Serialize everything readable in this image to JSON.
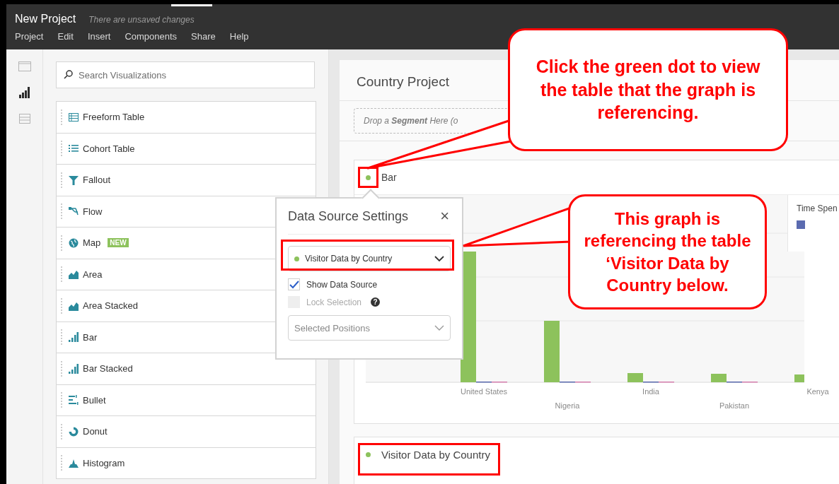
{
  "window": {
    "title": "New Project",
    "status": "There are unsaved changes"
  },
  "menu": [
    "Project",
    "Edit",
    "Insert",
    "Components",
    "Share",
    "Help"
  ],
  "rail": [
    {
      "selected": false
    },
    {
      "selected": true
    },
    {
      "selected": false
    }
  ],
  "search": {
    "placeholder": "Search Visualizations"
  },
  "visualizations": [
    {
      "label": "Freeform Table"
    },
    {
      "label": "Cohort Table"
    },
    {
      "label": "Fallout"
    },
    {
      "label": "Flow"
    },
    {
      "label": "Map",
      "badge": "NEW"
    },
    {
      "label": "Area"
    },
    {
      "label": "Area Stacked"
    },
    {
      "label": "Bar"
    },
    {
      "label": "Bar Stacked"
    },
    {
      "label": "Bullet"
    },
    {
      "label": "Donut"
    },
    {
      "label": "Histogram"
    }
  ],
  "project": {
    "title": "Country Project",
    "segment_drop": "Drop a **Segment** Here (o",
    "bar_panel": {
      "title": "Bar",
      "legend": "Time Spen",
      "categories": [
        "United States",
        "Nigeria",
        "India",
        "Pakistan",
        "Kenya"
      ]
    },
    "table_panel": {
      "title": "Visitor Data by Country"
    }
  },
  "popover": {
    "title": "Data Source Settings",
    "close": "×",
    "source": {
      "value": "Visitor Data by Country"
    },
    "options": [
      {
        "label": "Show Data Source",
        "checked": true,
        "disabled": false
      },
      {
        "label": "Lock Selection",
        "checked": false,
        "disabled": true,
        "help": "?"
      }
    ],
    "positions": {
      "placeholder": "Selected Positions"
    }
  },
  "callouts": [
    "Click the green dot to view the table that the graph is referencing.",
    "This graph is referencing the table ‘Visitor Data by Country below."
  ]
}
